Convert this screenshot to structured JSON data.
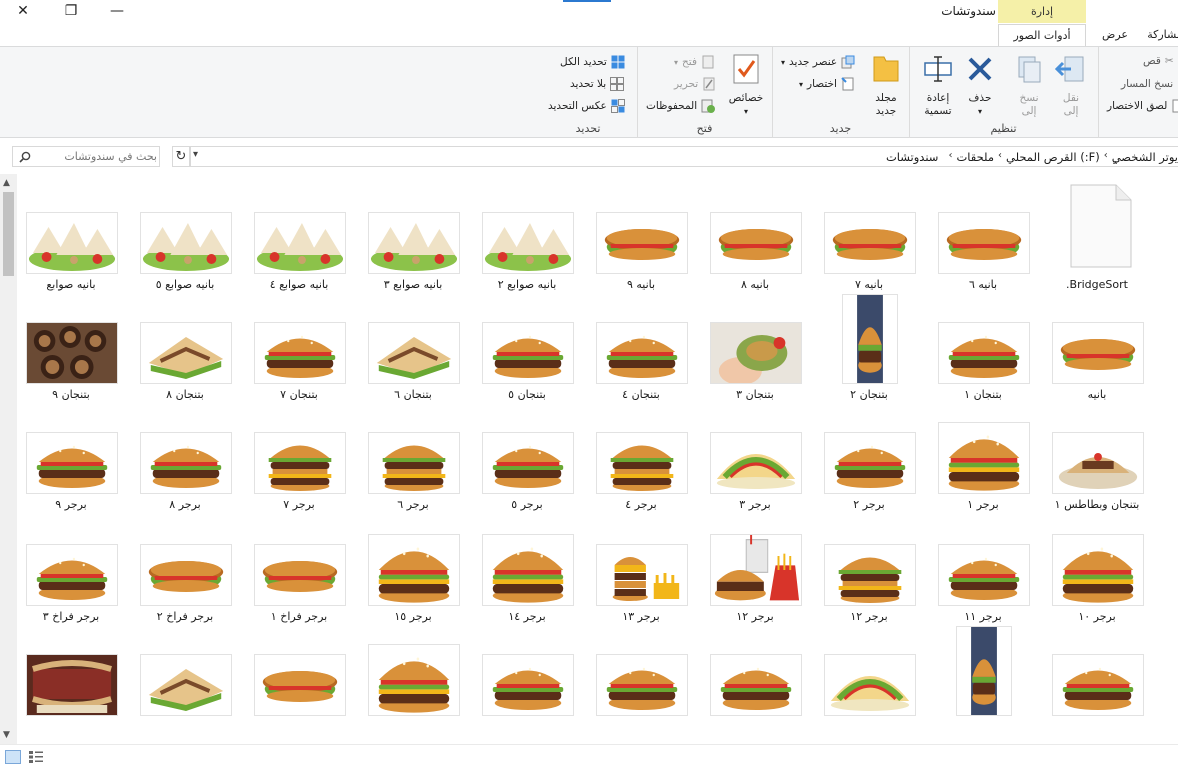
{
  "window": {
    "title": "سندوتشات",
    "context_tab": "إدارة",
    "close_glyph": "✕",
    "max_glyph": "❐",
    "min_glyph": "—"
  },
  "tabs": {
    "share": "مشاركة",
    "view": "عرض",
    "picture_tools": "أدوات الصور"
  },
  "help_glyph": "?",
  "ribbon": {
    "clipboard": {
      "cut": "قص",
      "copy_path": "نسخ المسار",
      "paste_shortcut": "لصق الاختصار"
    },
    "organize": {
      "label": "تنظيم",
      "move_to": "نقل\nإلى",
      "copy_to": "نسخ\nإلى",
      "delete": "حذف",
      "rename": "إعادة\nتسمية"
    },
    "new": {
      "label": "جديد",
      "new_folder": "مجلد\nجديد",
      "new_item": "عنصر جديد",
      "easy_access": "اختصار"
    },
    "open": {
      "label": "فتح",
      "properties": "خصائص",
      "open": "فتح",
      "edit": "تحرير",
      "history": "المحفوظات"
    },
    "select": {
      "label": "تحديد",
      "select_all": "تحديد الكل",
      "select_none": "بلا تحديد",
      "invert": "عكس التحديد"
    }
  },
  "address": {
    "search_placeholder": "بحث في سندوتشات",
    "refresh_glyph": "↻",
    "breadcrumb": [
      "ٍيوتر الشخصي",
      "القرص المحلي (:F)",
      "ملحقات",
      "سندوتشات"
    ],
    "sep": "‹"
  },
  "items": [
    {
      "label": "BridgeSort.",
      "kind": "file"
    },
    {
      "label": "بانيه ٦",
      "kind": "sub"
    },
    {
      "label": "بانيه ٧",
      "kind": "sub"
    },
    {
      "label": "بانيه ٨",
      "kind": "sub"
    },
    {
      "label": "بانيه ٩",
      "kind": "sub"
    },
    {
      "label": "بانيه صوابع ٢",
      "kind": "wrap"
    },
    {
      "label": "بانيه صوابع ٣",
      "kind": "wrap"
    },
    {
      "label": "بانيه صوابع ٤",
      "kind": "wrap"
    },
    {
      "label": "بانيه صوابع ٥",
      "kind": "wrap"
    },
    {
      "label": "بانيه صوابع",
      "kind": "wrap"
    },
    {
      "label": "بانيه",
      "kind": "sub"
    },
    {
      "label": "بتنجان ١",
      "kind": "burger"
    },
    {
      "label": "بتنجان ٢",
      "kind": "burger_tall"
    },
    {
      "label": "بتنجان ٣",
      "kind": "hand"
    },
    {
      "label": "بتنجان ٤",
      "kind": "burger"
    },
    {
      "label": "بتنجان ٥",
      "kind": "burger"
    },
    {
      "label": "بتنجان ٦",
      "kind": "toast"
    },
    {
      "label": "بتنجان ٧",
      "kind": "burger"
    },
    {
      "label": "بتنجان ٨",
      "kind": "toast"
    },
    {
      "label": "بتنجان ٩",
      "kind": "eggplant"
    },
    {
      "label": "بتنجان وبطاطس ١",
      "kind": "pita"
    },
    {
      "label": "برجر ١",
      "kind": "burger_big"
    },
    {
      "label": "برجر ٢",
      "kind": "burger"
    },
    {
      "label": "برجر ٣",
      "kind": "taco"
    },
    {
      "label": "برجر ٤",
      "kind": "burger_double"
    },
    {
      "label": "برجر ٥",
      "kind": "burger"
    },
    {
      "label": "برجر ٦",
      "kind": "burger_double"
    },
    {
      "label": "برجر ٧",
      "kind": "burger_double"
    },
    {
      "label": "برجر ٨",
      "kind": "burger"
    },
    {
      "label": "برجر ٩",
      "kind": "burger"
    },
    {
      "label": "برجر ١٠",
      "kind": "burger_big"
    },
    {
      "label": "برجر ١١",
      "kind": "burger"
    },
    {
      "label": "برجر ١٢",
      "kind": "burger_double"
    },
    {
      "label": "برجر ١٢",
      "kind": "combo"
    },
    {
      "label": "برجر ١٣",
      "kind": "stack"
    },
    {
      "label": "برجر ١٤",
      "kind": "burger_big"
    },
    {
      "label": "برجر ١٥",
      "kind": "burger_big"
    },
    {
      "label": "برجر فراخ ١",
      "kind": "sub"
    },
    {
      "label": "برجر فراخ ٢",
      "kind": "sub"
    },
    {
      "label": "برجر فراخ ٣",
      "kind": "burger"
    },
    {
      "label": "",
      "kind": "burger"
    },
    {
      "label": "",
      "kind": "burger_tall"
    },
    {
      "label": "",
      "kind": "taco"
    },
    {
      "label": "",
      "kind": "burger"
    },
    {
      "label": "",
      "kind": "burger"
    },
    {
      "label": "",
      "kind": "burger"
    },
    {
      "label": "",
      "kind": "burger_big"
    },
    {
      "label": "",
      "kind": "sub"
    },
    {
      "label": "",
      "kind": "toast"
    },
    {
      "label": "",
      "kind": "deli"
    }
  ],
  "colors": {
    "bun": "#d9913a",
    "bun_dark": "#b86a22",
    "lettuce": "#6aa833",
    "tomato": "#d8342a",
    "patty": "#5a2e18",
    "cheese": "#f2b619",
    "wrap": "#efe2c6",
    "accent": "#2b79d0",
    "context_tab": "#f5f0a8"
  }
}
